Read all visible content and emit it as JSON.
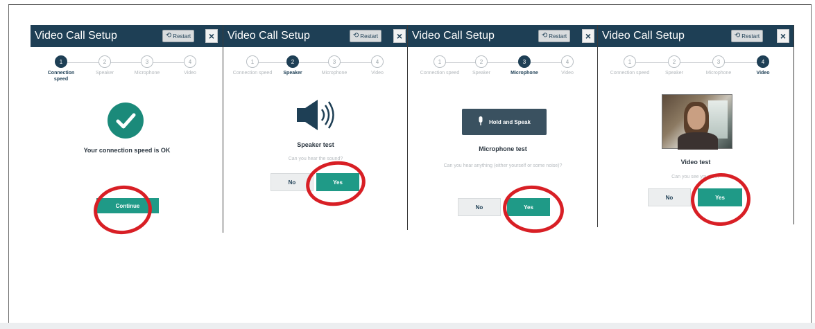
{
  "panels": [
    {
      "title": "Video Call Setup",
      "restart_label": "Restart",
      "close_label": "×",
      "steps": [
        "Connection speed",
        "Speaker",
        "Microphone",
        "Video"
      ],
      "step_numbers": [
        "1",
        "2",
        "3",
        "4"
      ],
      "active_step": 1,
      "message": "Your connection speed is OK",
      "primary_button": "Continue"
    },
    {
      "title": "Video Call Setup",
      "restart_label": "Restart",
      "close_label": "×",
      "steps": [
        "Connection speed",
        "Speaker",
        "Microphone",
        "Video"
      ],
      "step_numbers": [
        "1",
        "2",
        "3",
        "4"
      ],
      "active_step": 2,
      "heading": "Speaker test",
      "question": "Can you hear the sound?",
      "no_label": "No",
      "yes_label": "Yes"
    },
    {
      "title": "Video Call Setup",
      "restart_label": "Restart",
      "close_label": "×",
      "steps": [
        "Connection speed",
        "Speaker",
        "Microphone",
        "Video"
      ],
      "step_numbers": [
        "1",
        "2",
        "3",
        "4"
      ],
      "active_step": 3,
      "hold_button": "Hold and Speak",
      "heading": "Microphone test",
      "question": "Can you hear anything (either yourself or some noise)?",
      "no_label": "No",
      "yes_label": "Yes"
    },
    {
      "title": "Video Call Setup",
      "restart_label": "Restart",
      "close_label": "×",
      "steps": [
        "Connection speed",
        "Speaker",
        "Microphone",
        "Video"
      ],
      "step_numbers": [
        "1",
        "2",
        "3",
        "4"
      ],
      "active_step": 4,
      "heading": "Video test",
      "question": "Can you see yourself?",
      "no_label": "No",
      "yes_label": "Yes"
    }
  ],
  "colors": {
    "header": "#1e3f55",
    "accent_teal": "#1f9a87",
    "highlight_red": "#d81f25"
  },
  "icons": [
    "restart-icon",
    "close-icon",
    "checkmark-icon",
    "speaker-icon",
    "microphone-icon",
    "webcam-video-preview"
  ]
}
